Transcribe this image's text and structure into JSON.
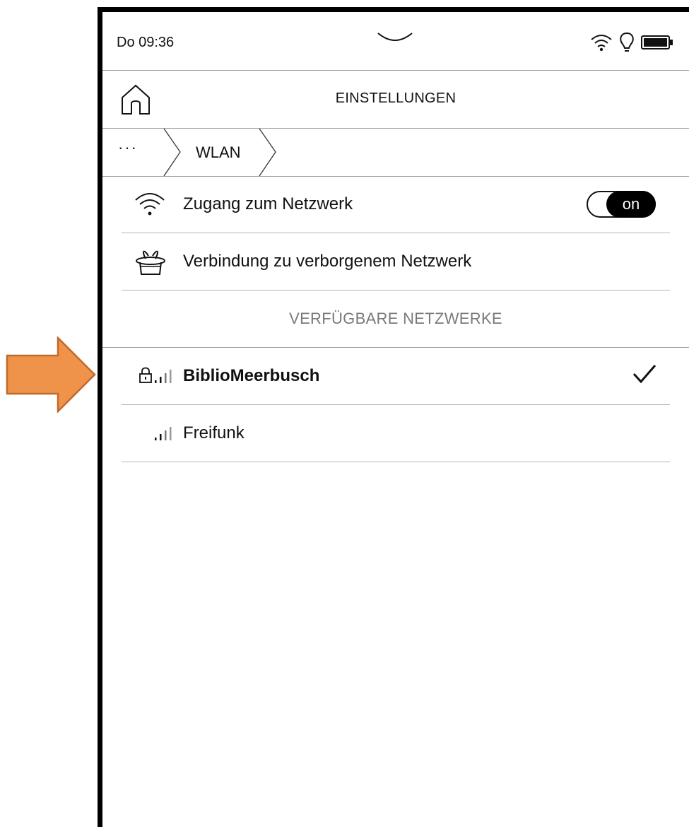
{
  "status_bar": {
    "time": "Do 09:36",
    "icons": [
      "wifi-icon",
      "lightbulb-icon",
      "battery-icon"
    ]
  },
  "header": {
    "title": "EINSTELLUNGEN",
    "home_icon": "home-icon"
  },
  "breadcrumb": {
    "overflow": "···",
    "current": "WLAN"
  },
  "settings": {
    "network_access": {
      "label": "Zugang zum Netzwerk",
      "toggle_state": "on"
    },
    "hidden_network": {
      "label": "Verbindung zu verborgenem Netzwerk"
    }
  },
  "available_networks": {
    "header": "VERFÜGBARE NETZWERKE",
    "items": [
      {
        "name": "BiblioMeerbusch",
        "secured": true,
        "connected": true
      },
      {
        "name": "Freifunk",
        "secured": false,
        "connected": false
      }
    ]
  },
  "colors": {
    "callout_arrow": "#f0934a",
    "callout_arrow_border": "#c0692a"
  }
}
